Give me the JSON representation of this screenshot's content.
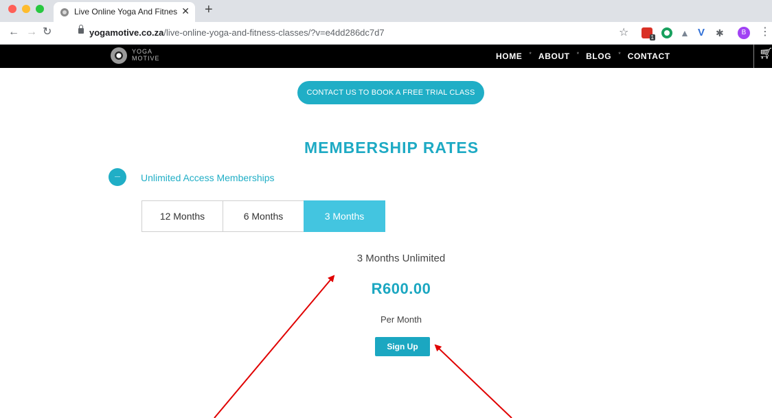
{
  "browser": {
    "tab_title": "Live Online Yoga And Fitness C",
    "tab_close": "✕",
    "new_tab": "+",
    "url_host": "yogamotive.co.za",
    "url_path": "/live-online-yoga-and-fitness-classes/?v=e4dd286dc7d7",
    "profile_initial": "B",
    "ext_badge": "1",
    "icons": {
      "back": "arrow-left-icon",
      "forward": "arrow-right-icon",
      "reload": "reload-icon",
      "lock": "lock-icon",
      "bookmark": "star-icon",
      "extensions": "puzzle-icon",
      "menu": "kebab-menu-icon"
    }
  },
  "site": {
    "logo_line1": "YOGA",
    "logo_line2": "MOTIVE",
    "nav": [
      "HOME",
      "ABOUT",
      "BLOG",
      "CONTACT"
    ],
    "nav_separator": "*",
    "cart_icon": "shopping-cart-icon"
  },
  "content": {
    "cta_label": "CONTACT US TO BOOK A FREE TRIAL CLASS",
    "title": "MEMBERSHIP RATES",
    "accordion_title": "Unlimited Access Memberships",
    "tabs": [
      {
        "label": "12 Months",
        "active": false
      },
      {
        "label": "6 Months",
        "active": false
      },
      {
        "label": "3 Months",
        "active": true
      }
    ],
    "plan_name": "3 Months Unlimited",
    "price": "R600.00",
    "period": "Per Month",
    "signup_label": "Sign Up"
  },
  "colors": {
    "accent": "#20aec6",
    "active_tab": "#43c5e0",
    "header_bg": "#000000",
    "annotation_arrow": "#e00000"
  }
}
